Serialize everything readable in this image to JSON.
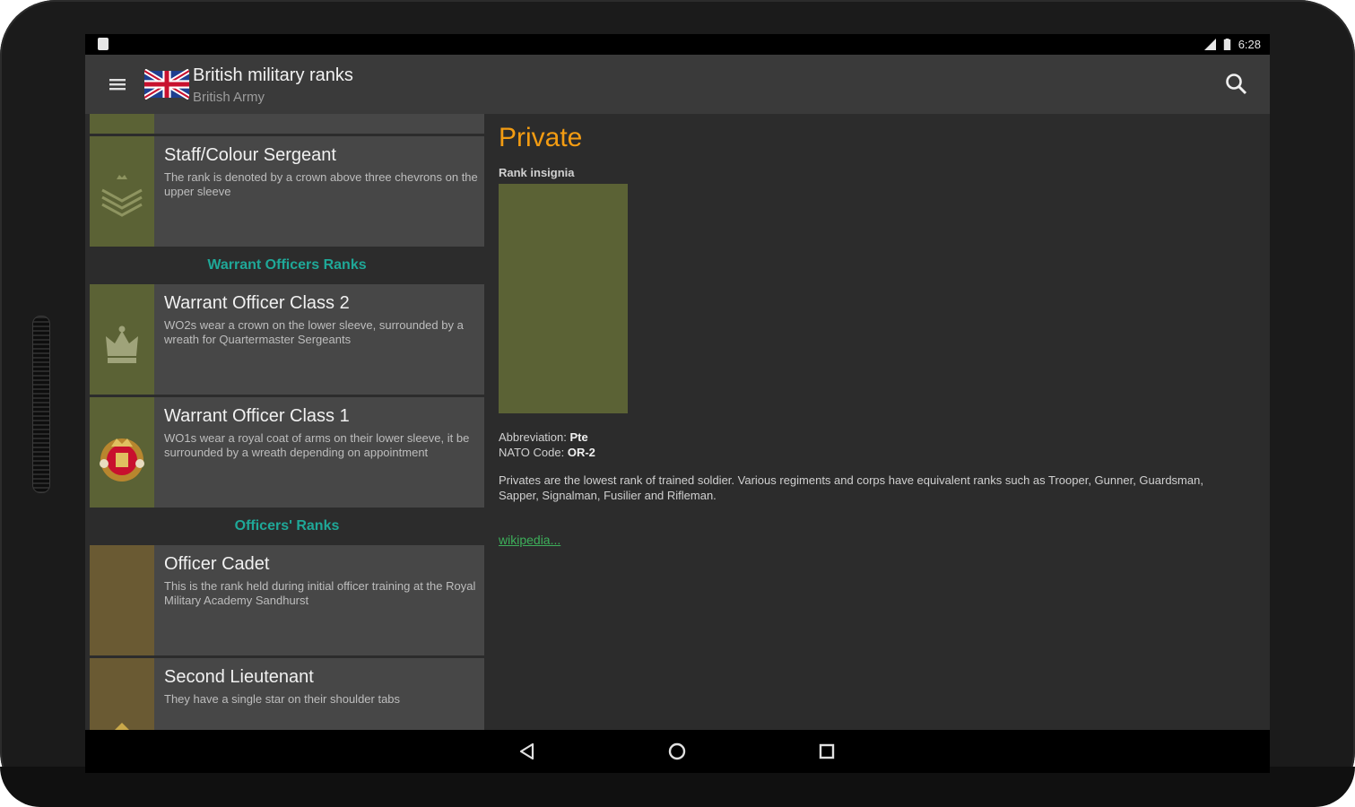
{
  "status_bar": {
    "time": "6:28"
  },
  "app_bar": {
    "title": "British military ranks",
    "subtitle": "British Army",
    "menu_icon": "hamburger-menu-icon",
    "flag_icon": "union-jack-flag-icon",
    "search_icon": "search-icon"
  },
  "rank_list": {
    "items": [
      {
        "title": "Staff/Colour Sergeant",
        "description": "The rank is denoted by a crown above three chevrons on the upper sleeve",
        "insignia": "crown-chevrons-icon"
      },
      {
        "section": "Warrant Officers Ranks"
      },
      {
        "title": "Warrant Officer Class 2",
        "description": "WO2s wear a crown on the lower sleeve, surrounded by a wreath for Quartermaster Sergeants",
        "insignia": "crown-icon"
      },
      {
        "title": "Warrant Officer Class 1",
        "description": "WO1s wear a royal coat of arms on their lower sleeve, it be surrounded by a wreath depending on appointment",
        "insignia": "royal-coat-of-arms-icon"
      },
      {
        "section": "Officers' Ranks"
      },
      {
        "title": "Officer Cadet",
        "description": "This is the rank held during initial officer training at the Royal Military Academy Sandhurst"
      },
      {
        "title": "Second Lieutenant",
        "description": "They have a single star on their shoulder tabs",
        "insignia": "star-icon"
      }
    ]
  },
  "detail": {
    "title": "Private",
    "insignia_label": "Rank insignia",
    "abbreviation_label": "Abbreviation:",
    "abbreviation_value": "Pte",
    "nato_label": "NATO Code:",
    "nato_value": "OR-2",
    "description": "Privates are the lowest rank of trained soldier. Various regiments and corps have equivalent ranks such as Trooper, Gunner, Guardsman, Sapper, Signalman, Fusilier and Rifleman.",
    "link": "wikipedia..."
  },
  "colors": {
    "accent_title": "#f39c12",
    "section_header": "#1fa898",
    "link": "#3daf5a",
    "insignia_olive": "#5b6235",
    "insignia_brown": "#6a5a33"
  },
  "nav_bar": {
    "back_icon": "back-icon",
    "home_icon": "home-icon",
    "recents_icon": "recents-icon"
  }
}
